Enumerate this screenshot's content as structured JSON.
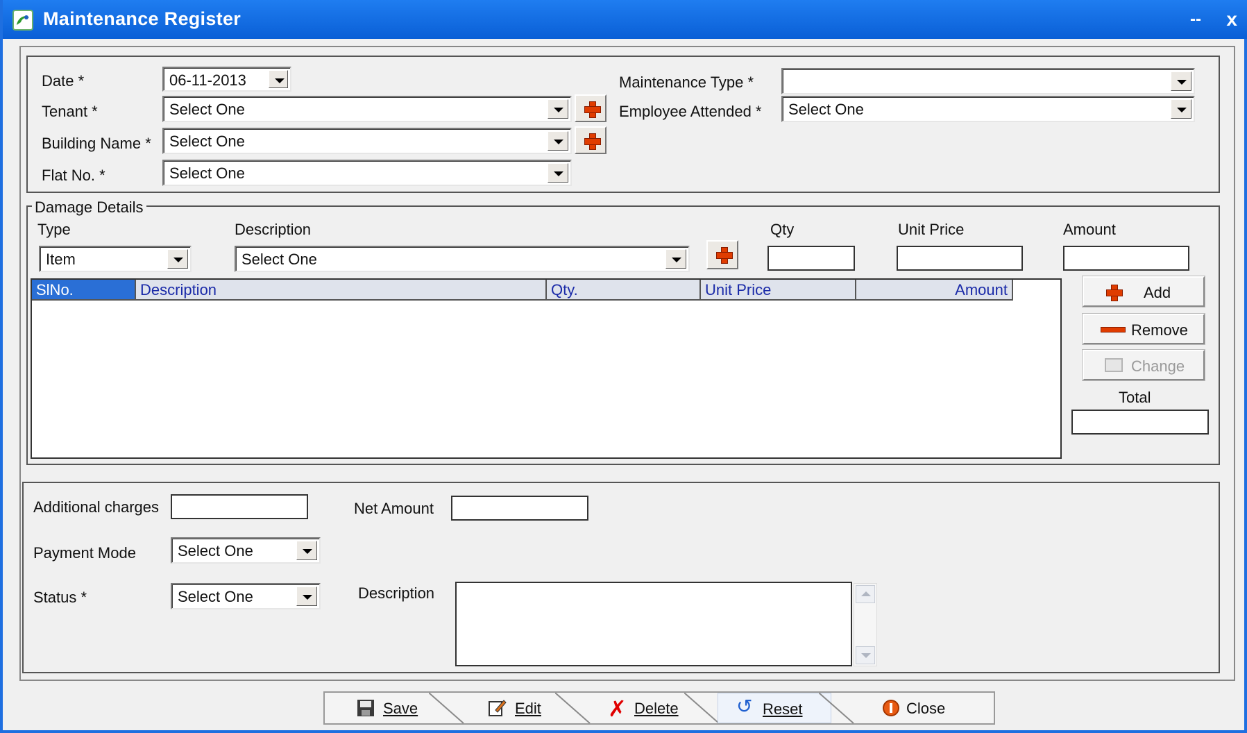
{
  "window": {
    "title": "Maintenance Register",
    "minimize": "--",
    "close": "x"
  },
  "header": {
    "date_label": "Date *",
    "date_value": "06-11-2013",
    "tenant_label": "Tenant *",
    "tenant_value": "Select One",
    "building_label": "Building Name *",
    "building_value": "Select One",
    "flat_label": "Flat No. *",
    "flat_value": "Select One",
    "maint_type_label": "Maintenance Type *",
    "maint_type_value": "",
    "employee_label": "Employee Attended *",
    "employee_value": "Select One"
  },
  "damage": {
    "legend": "Damage Details",
    "type_label": "Type",
    "type_value": "Item",
    "desc_label": "Description",
    "desc_value": "Select One",
    "qty_label": "Qty",
    "unit_price_label": "Unit Price",
    "amount_label": "Amount",
    "grid_headers": [
      "SlNo.",
      "Description",
      "Qty.",
      "Unit Price",
      "Amount"
    ],
    "add_label": "Add",
    "remove_label": "Remove",
    "change_label": "Change",
    "total_label": "Total"
  },
  "footer_form": {
    "additional_label": "Additional charges",
    "net_label": "Net Amount",
    "payment_label": "Payment Mode",
    "payment_value": "Select One",
    "status_label": "Status *",
    "status_value": "Select One",
    "description_label": "Description"
  },
  "toolbar": {
    "save": "Save",
    "edit": "Edit",
    "delete": "Delete",
    "reset": "Reset",
    "close": "Close"
  },
  "colors": {
    "title_bar": "#0a5fd6",
    "plus_icon": "#e03c00",
    "grid_header_selected": "#2a6fd6"
  }
}
